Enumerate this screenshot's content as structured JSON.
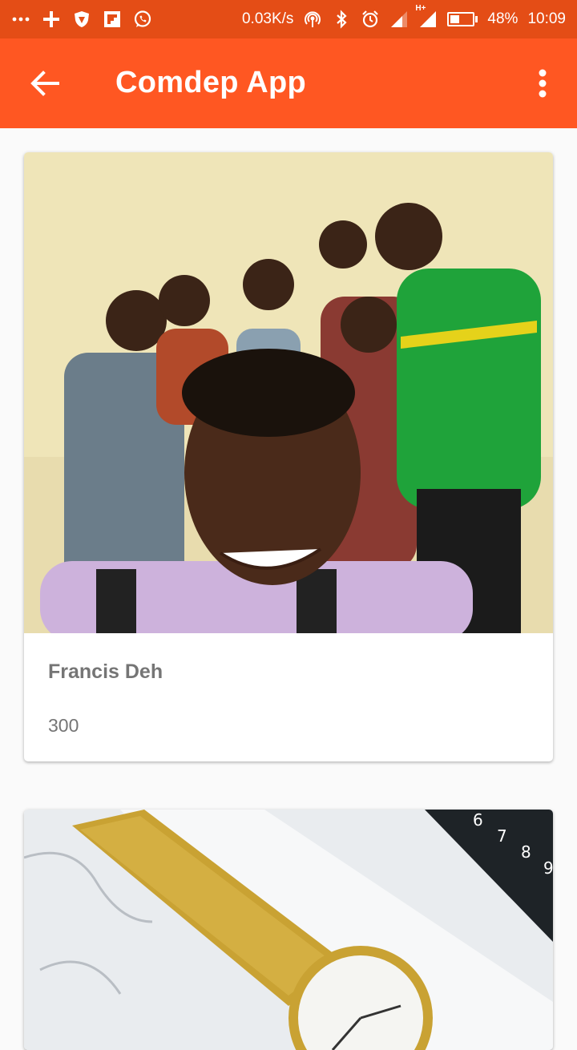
{
  "status_bar": {
    "speed": "0.03K/s",
    "network_type": "H+",
    "battery_percent": "48%",
    "battery_level": 0.48,
    "time": "10:09",
    "icons": [
      "more-dots-icon",
      "plus-icon",
      "shield-icon",
      "flipboard-icon",
      "whatsapp-icon",
      "hotspot-icon",
      "bluetooth-icon",
      "alarm-icon",
      "signal-icon",
      "signal-icon",
      "battery-icon"
    ]
  },
  "app_bar": {
    "title": "Comdep App",
    "back_icon": "arrow-left-icon",
    "menu_icon": "more-vert-icon",
    "color": "#ff5722"
  },
  "cards": [
    {
      "image": "group-selfie-photo",
      "name": "Francis Deh",
      "value": "300"
    },
    {
      "image": "gold-watch-photo"
    }
  ]
}
